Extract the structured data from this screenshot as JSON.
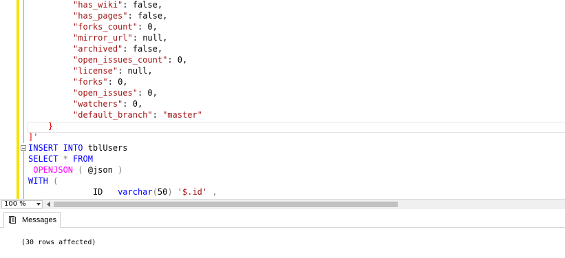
{
  "editor": {
    "lines": {
      "l1": {
        "key": "\"has_wiki\"",
        "sep": ": ",
        "val": "false",
        "end": ","
      },
      "l2": {
        "key": "\"has_pages\"",
        "sep": ": ",
        "val": "false",
        "end": ","
      },
      "l3": {
        "key": "\"forks_count\"",
        "sep": ": ",
        "val": "0",
        "end": ","
      },
      "l4": {
        "key": "\"mirror_url\"",
        "sep": ": ",
        "val": "null",
        "end": ","
      },
      "l5": {
        "key": "\"archived\"",
        "sep": ": ",
        "val": "false",
        "end": ","
      },
      "l6": {
        "key": "\"open_issues_count\"",
        "sep": ": ",
        "val": "0",
        "end": ","
      },
      "l7": {
        "key": "\"license\"",
        "sep": ": ",
        "val": "null",
        "end": ","
      },
      "l8": {
        "key": "\"forks\"",
        "sep": ": ",
        "val": "0",
        "end": ","
      },
      "l9": {
        "key": "\"open_issues\"",
        "sep": ": ",
        "val": "0",
        "end": ","
      },
      "l10": {
        "key": "\"watchers\"",
        "sep": ": ",
        "val": "0",
        "end": ","
      },
      "l11": {
        "key": "\"default_branch\"",
        "sep": ": ",
        "val": "\"master\""
      },
      "l12": {
        "text": "}"
      },
      "l13": {
        "text": "]'"
      },
      "l14": {
        "kw": "INSERT INTO",
        "rest": " tblUsers"
      },
      "l15": {
        "kw": "SELECT",
        "op": " * ",
        "kw2": "FROM"
      },
      "l16": {
        "fn": "OPENJSON",
        "op1": " ( ",
        "var": "@json",
        "op2": " )"
      },
      "l17": {
        "kw": "WITH",
        "op": " ("
      },
      "l18": {
        "col": "ID",
        "type": "varchar",
        "op1": "(",
        "num": "50",
        "op2": ") ",
        "path": "'$.id'",
        "op3": " ,"
      }
    }
  },
  "status": {
    "zoom": "100 %"
  },
  "results": {
    "tab_label": "Messages",
    "message": "(30 rows affected)"
  }
}
